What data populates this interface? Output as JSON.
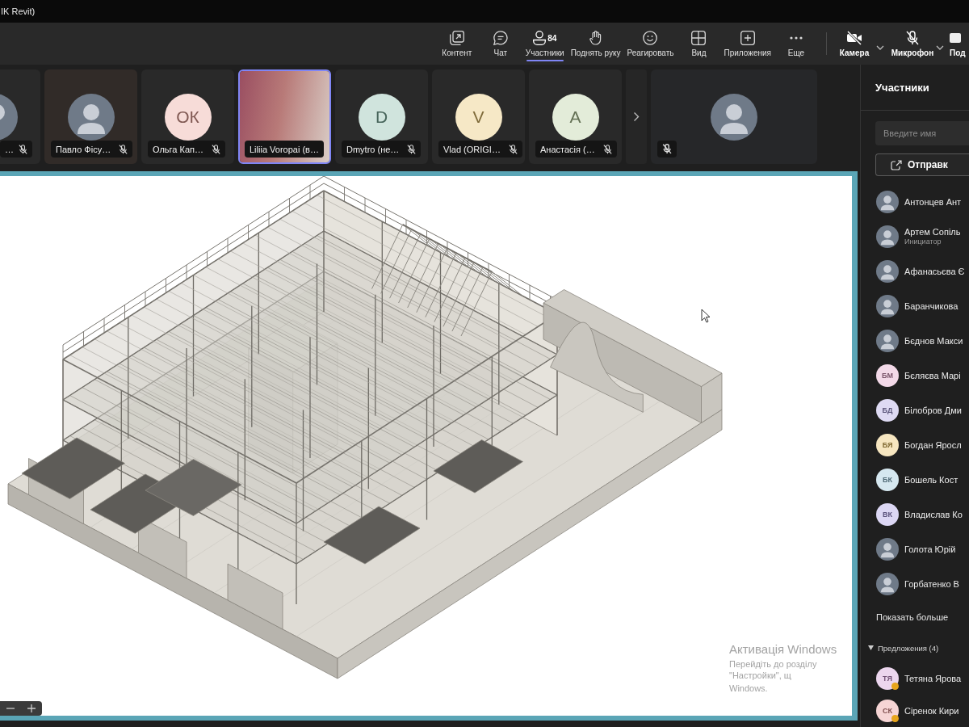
{
  "window": {
    "title": "IK Revit)"
  },
  "toolbar": {
    "items": [
      {
        "kind": "content",
        "label": "Контент",
        "selected": false
      },
      {
        "kind": "chat",
        "label": "Чат",
        "selected": false
      },
      {
        "kind": "people",
        "label": "Участники",
        "count": "84",
        "selected": true
      },
      {
        "kind": "hand",
        "label": "Поднять руку",
        "selected": false
      },
      {
        "kind": "react",
        "label": "Реагировать",
        "selected": false
      },
      {
        "kind": "view",
        "label": "Вид",
        "selected": false
      },
      {
        "kind": "apps",
        "label": "Приложения",
        "selected": false
      },
      {
        "kind": "more",
        "label": "Еще",
        "selected": false
      }
    ],
    "devices": [
      {
        "kind": "camera",
        "label": "Камера",
        "off": true
      },
      {
        "kind": "mic",
        "label": "Микрофон",
        "off": true
      }
    ],
    "share": {
      "label": "Под"
    }
  },
  "strip": {
    "tiles": [
      {
        "name": "…",
        "kind": "photo_partial",
        "muted": true,
        "speaking": false
      },
      {
        "name": "Павло Фісу…",
        "kind": "photo",
        "muted": true,
        "speaking": false
      },
      {
        "name": "Ольга Кап…",
        "kind": "initials",
        "initials": "ОК",
        "color": "#f7dcd8",
        "muted": true,
        "speaking": false
      },
      {
        "name": "Liliia Voropai (в…",
        "kind": "video",
        "muted": false,
        "speaking": true
      },
      {
        "name": "Dmytro (не…",
        "kind": "initials",
        "initials": "D",
        "color": "#d0e4dd",
        "muted": true,
        "speaking": false
      },
      {
        "name": "Vlad (ORIGI…",
        "kind": "initials",
        "initials": "V",
        "color": "#f6e8c6",
        "muted": true,
        "speaking": false
      },
      {
        "name": "Анастасія (…",
        "kind": "initials",
        "initials": "А",
        "color": "#e3ecd9",
        "muted": true,
        "speaking": false
      }
    ],
    "spotlight_tile": {
      "kind": "photo",
      "muted": true
    }
  },
  "participants_panel": {
    "title": "Участники",
    "search": {
      "placeholder": "Введите имя"
    },
    "invite_button": {
      "label": "Отправк"
    },
    "people": [
      {
        "name": "Антонцев Ант",
        "kind": "photo"
      },
      {
        "name": "Артем Сопіль",
        "role": "Инициатор",
        "kind": "photo"
      },
      {
        "name": "Афанасьєва Є",
        "kind": "photo"
      },
      {
        "name": "Баранчикова",
        "kind": "photo"
      },
      {
        "name": "Бєднов Макси",
        "kind": "photo"
      },
      {
        "name": "Бєляєва Марі",
        "kind": "initials",
        "initials": "БМ",
        "color": "#f3d9e8"
      },
      {
        "name": "Білобров Дми",
        "kind": "initials",
        "initials": "БД",
        "color": "#dedaf3"
      },
      {
        "name": "Богдан Яросл",
        "kind": "initials",
        "initials": "БЯ",
        "color": "#f6e6c0"
      },
      {
        "name": "Бошель Кост",
        "kind": "initials",
        "initials": "БК",
        "color": "#d6e8f0"
      },
      {
        "name": "Владислав Ко",
        "kind": "initials",
        "initials": "ВК",
        "color": "#dcd7f4"
      },
      {
        "name": "Голота Юрій",
        "kind": "photo"
      },
      {
        "name": "Горбатенко В",
        "kind": "photo"
      }
    ],
    "show_more": "Показать больше",
    "suggestions": {
      "title": "Предложения (4)",
      "expanded": true,
      "people": [
        {
          "name": "Тетяна Ярова",
          "kind": "initials",
          "initials": "ТЯ",
          "color": "#ecd6ee",
          "status_dot": true
        },
        {
          "name": "Сіренок Кири",
          "kind": "initials",
          "initials": "СК",
          "color": "#f6d5d5",
          "status_dot": true
        }
      ]
    }
  },
  "shared_screen": {
    "activation": {
      "title": "Активація Windows",
      "hint": "Перейдіть до розділу \"Настройки\", щ",
      "hint_end": "Windows."
    }
  }
}
